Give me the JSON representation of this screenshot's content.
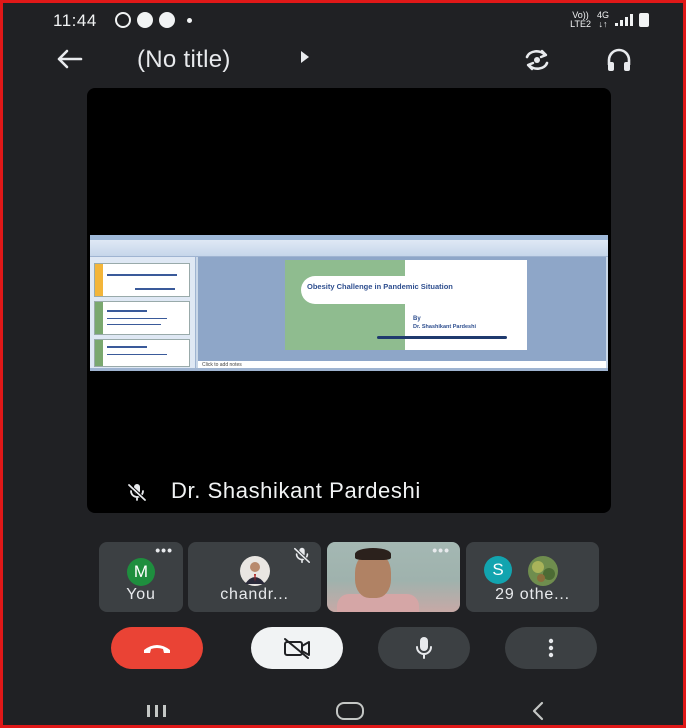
{
  "status_bar": {
    "time": "11:44",
    "network_top": "Vo))",
    "network_bottom": "LTE2",
    "data_type": "4G",
    "data_arrows": "↓↑"
  },
  "header": {
    "title": "(No title)",
    "back_icon": "arrow-left-icon",
    "switch_camera_icon": "switch-camera-icon",
    "audio_icon": "headphones-icon"
  },
  "presenter": {
    "name": "Dr. Shashikant Pardeshi",
    "mic_state": "muted",
    "shared_slide": {
      "title": "Obesity Challenge in Pandemic Situation",
      "by_label": "By",
      "author": "Dr. Shashikant Pardeshi",
      "notes_placeholder": "Click to add notes"
    }
  },
  "participants": [
    {
      "label": "You",
      "avatar_letter": "M",
      "avatar_color": "#1e8e3e"
    },
    {
      "label": "chandr...",
      "mic_state": "muted"
    },
    {
      "label": "",
      "type": "video"
    },
    {
      "label": "29 othe...",
      "avatar_letter": "S",
      "avatar_color": "#12a4af"
    }
  ],
  "controls": {
    "end_call_icon": "phone-hangup-icon",
    "camera_icon": "camera-off-icon",
    "mic_icon": "mic-icon",
    "more_icon": "more-vertical-icon",
    "end_call_color": "#ea4335"
  },
  "nav_bar": {
    "recents_icon": "recents-icon",
    "home_icon": "home-icon",
    "back_icon": "chevron-left-icon"
  }
}
